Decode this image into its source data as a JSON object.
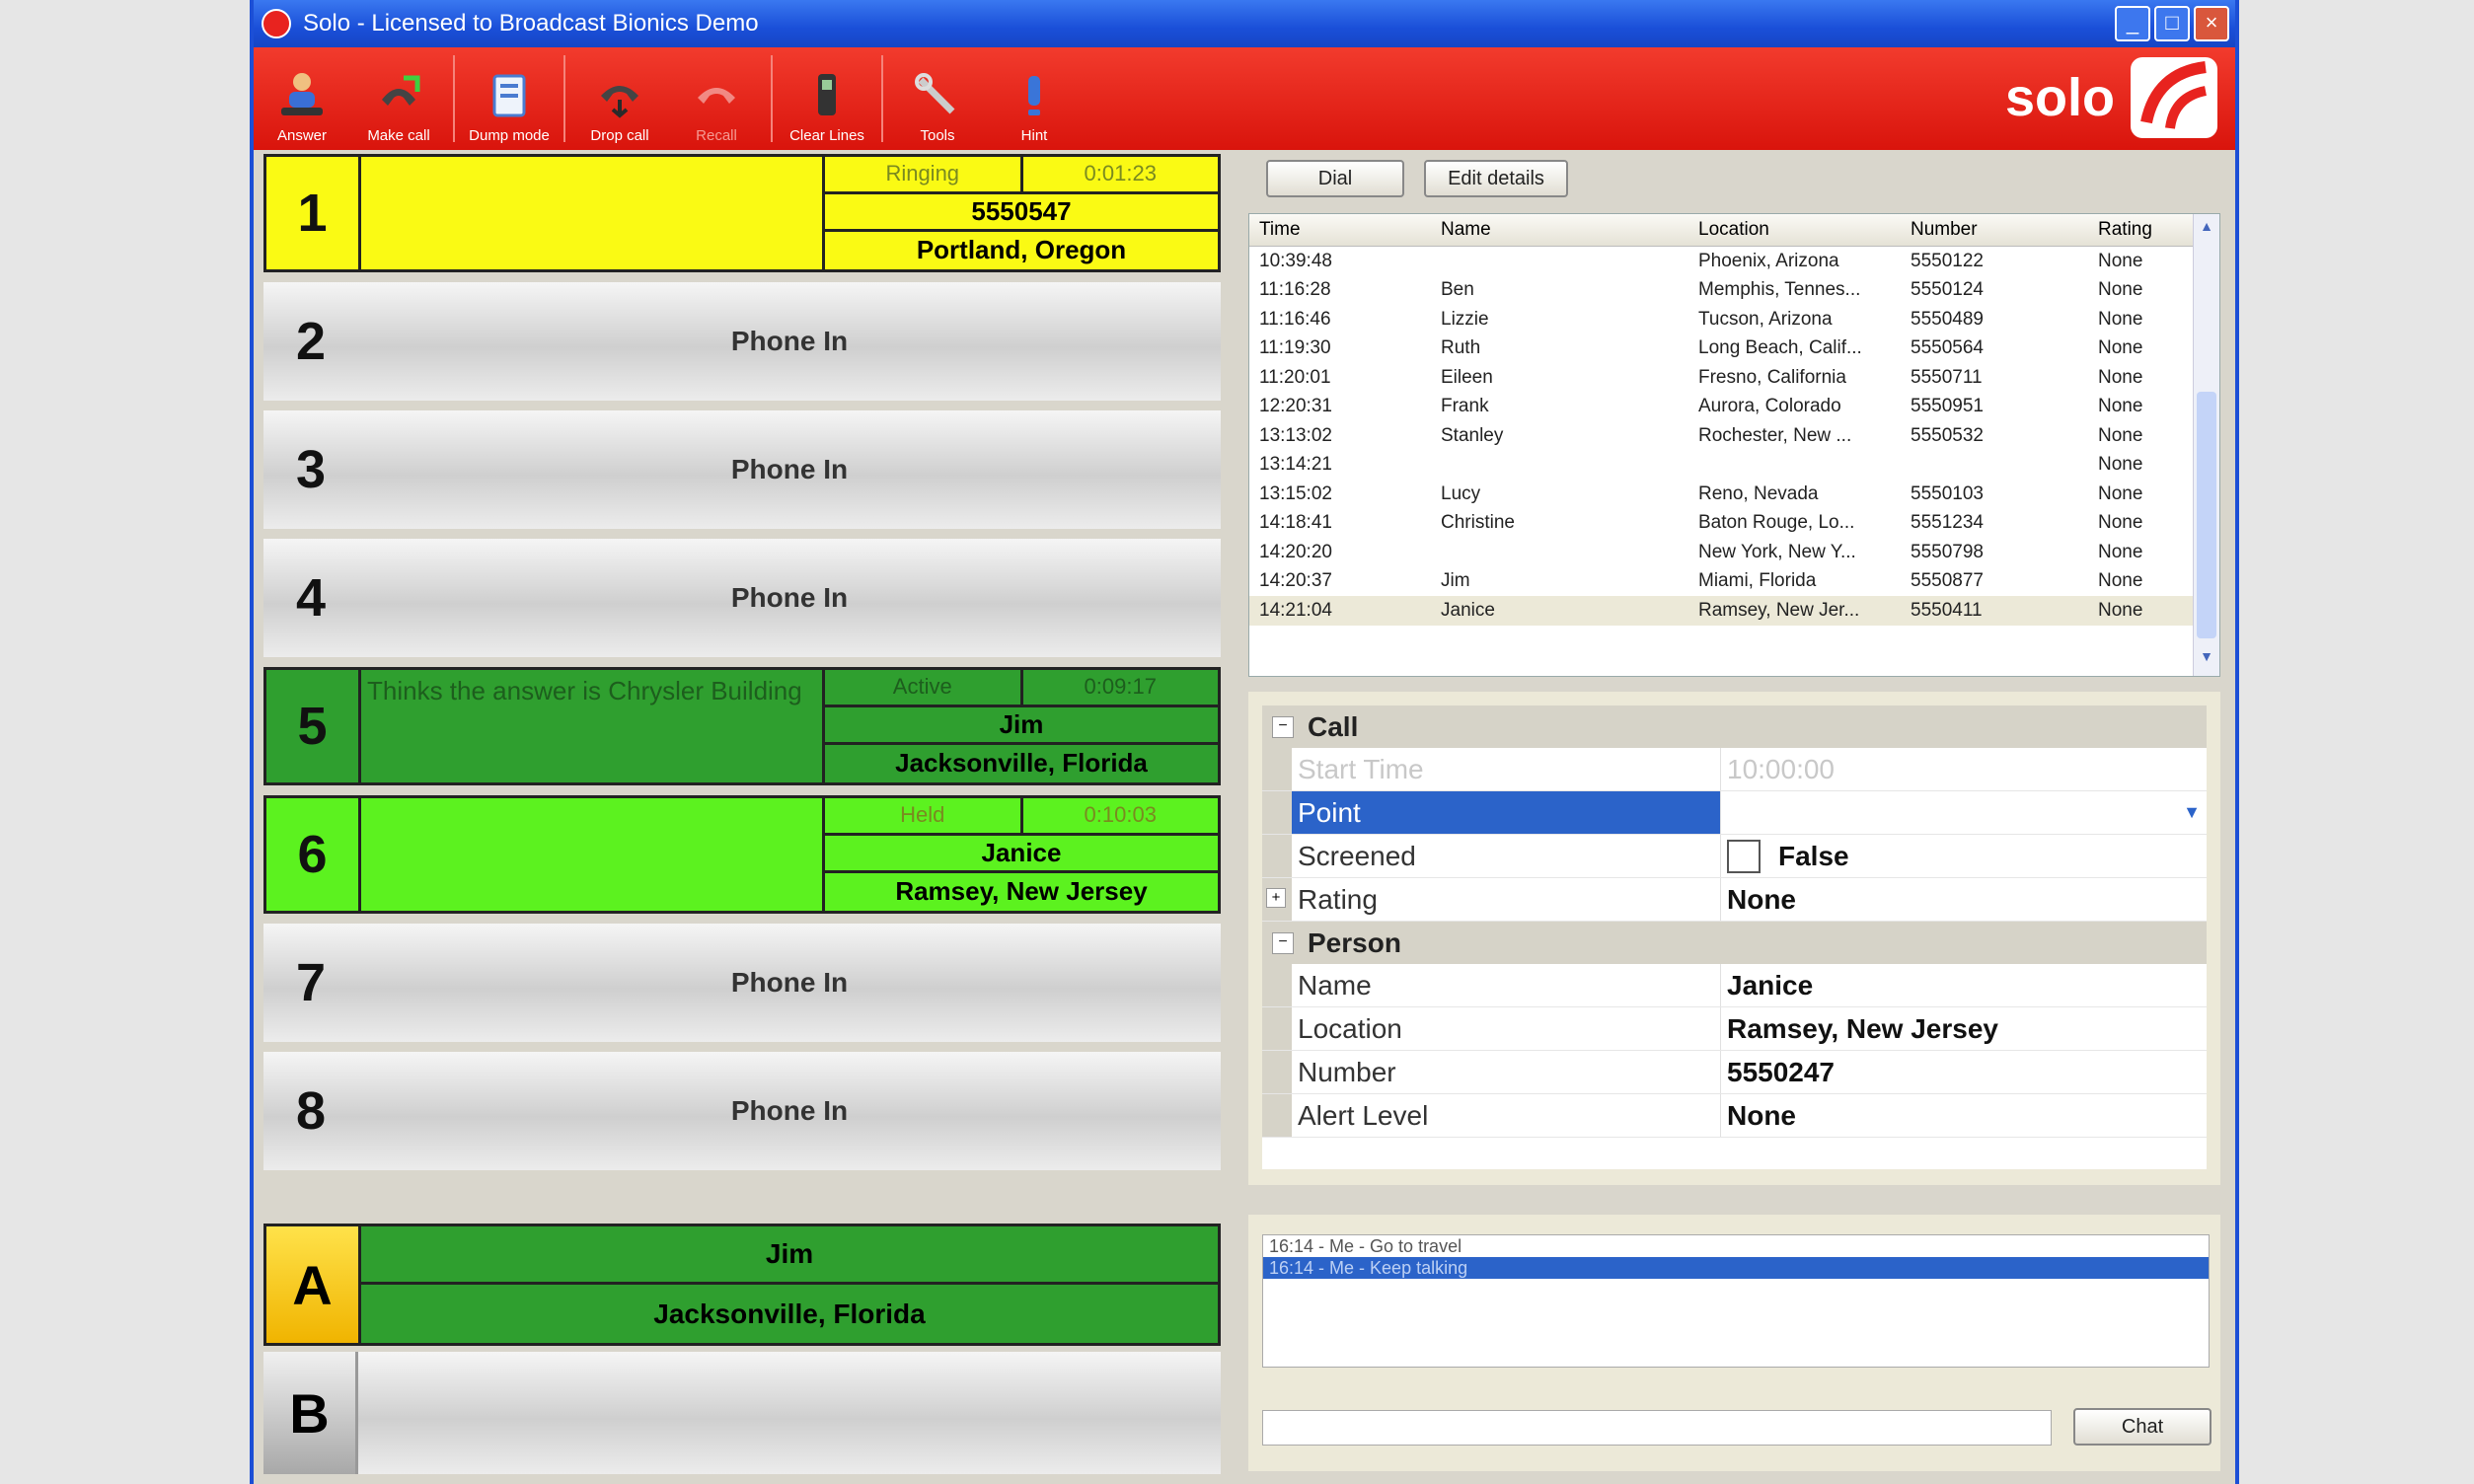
{
  "window": {
    "title": "Solo - Licensed to Broadcast Bionics Demo"
  },
  "toolbar": {
    "buttons": [
      {
        "label": "Answer",
        "icon": "answer-icon"
      },
      {
        "label": "Make call",
        "icon": "make-call-icon"
      },
      {
        "label": "Dump mode",
        "icon": "dump-mode-icon"
      },
      {
        "label": "Drop call",
        "icon": "drop-call-icon"
      },
      {
        "label": "Recall",
        "icon": "recall-icon"
      },
      {
        "label": "Clear Lines",
        "icon": "clear-lines-icon"
      },
      {
        "label": "Tools",
        "icon": "tools-icon"
      },
      {
        "label": "Hint",
        "icon": "hint-icon"
      }
    ],
    "logo_text": "solo"
  },
  "lines": {
    "l1": {
      "num": "1",
      "status": "Ringing",
      "timer": "0:01:23",
      "primary": "5550547",
      "location": "Portland, Oregon"
    },
    "l2": {
      "num": "2",
      "label": "Phone In"
    },
    "l3": {
      "num": "3",
      "label": "Phone In"
    },
    "l4": {
      "num": "4",
      "label": "Phone In"
    },
    "l5": {
      "num": "5",
      "note": "Thinks the answer is Chrysler Building",
      "status": "Active",
      "timer": "0:09:17",
      "primary": "Jim",
      "location": "Jacksonville, Florida"
    },
    "l6": {
      "num": "6",
      "status": "Held",
      "timer": "0:10:03",
      "primary": "Janice",
      "location": "Ramsey, New Jersey"
    },
    "l7": {
      "num": "7",
      "label": "Phone In"
    },
    "l8": {
      "num": "8",
      "label": "Phone In"
    },
    "hybridA": {
      "key": "A",
      "name": "Jim",
      "location": "Jacksonville, Florida"
    },
    "hybridB": {
      "key": "B"
    }
  },
  "call_actions": {
    "dial": "Dial",
    "edit": "Edit details"
  },
  "call_log": {
    "columns": {
      "time": "Time",
      "name": "Name",
      "location": "Location",
      "number": "Number",
      "rating": "Rating"
    },
    "rows": [
      {
        "time": "10:39:48",
        "name": "",
        "location": "Phoenix, Arizona",
        "number": "5550122",
        "rating": "None"
      },
      {
        "time": "11:16:28",
        "name": "Ben",
        "location": "Memphis, Tennes...",
        "number": "5550124",
        "rating": "None"
      },
      {
        "time": "11:16:46",
        "name": "Lizzie",
        "location": "Tucson, Arizona",
        "number": "5550489",
        "rating": "None"
      },
      {
        "time": "11:19:30",
        "name": "Ruth",
        "location": "Long Beach, Calif...",
        "number": "5550564",
        "rating": "None"
      },
      {
        "time": "11:20:01",
        "name": "Eileen",
        "location": "Fresno, California",
        "number": "5550711",
        "rating": "None"
      },
      {
        "time": "12:20:31",
        "name": "Frank",
        "location": "Aurora, Colorado",
        "number": "5550951",
        "rating": "None"
      },
      {
        "time": "13:13:02",
        "name": "Stanley",
        "location": "Rochester, New ...",
        "number": "5550532",
        "rating": "None"
      },
      {
        "time": "13:14:21",
        "name": "",
        "location": "",
        "number": "",
        "rating": "None"
      },
      {
        "time": "13:15:02",
        "name": "Lucy",
        "location": "Reno, Nevada",
        "number": "5550103",
        "rating": "None"
      },
      {
        "time": "14:18:41",
        "name": "Christine",
        "location": "Baton Rouge, Lo...",
        "number": "5551234",
        "rating": "None"
      },
      {
        "time": "14:20:20",
        "name": "",
        "location": "New York, New Y...",
        "number": "5550798",
        "rating": "None"
      },
      {
        "time": "14:20:37",
        "name": "Jim",
        "location": "Miami, Florida",
        "number": "5550877",
        "rating": "None"
      },
      {
        "time": "14:21:04",
        "name": "Janice",
        "location": "Ramsey, New Jer...",
        "number": "5550411",
        "rating": "None"
      }
    ]
  },
  "properties": {
    "cat_call": "Call",
    "start_time_k": "Start Time",
    "start_time_v": "10:00:00",
    "point_k": "Point",
    "screened_k": "Screened",
    "screened_v": "False",
    "rating_k": "Rating",
    "rating_v": "None",
    "cat_person": "Person",
    "name_k": "Name",
    "name_v": "Janice",
    "location_k": "Location",
    "location_v": "Ramsey, New Jersey",
    "number_k": "Number",
    "number_v": "5550247",
    "alert_k": "Alert Level",
    "alert_v": "None"
  },
  "chat": {
    "messages": [
      "16:14 - Me - Go to travel",
      "16:14 - Me - Keep talking"
    ],
    "send_label": "Chat"
  },
  "colors": {
    "toolbar_red": "#e8231f",
    "ringing_yellow": "#fafa14",
    "active_green": "#2f9f2f",
    "held_green": "#5cf21f",
    "selection_blue": "#2b63c9"
  }
}
